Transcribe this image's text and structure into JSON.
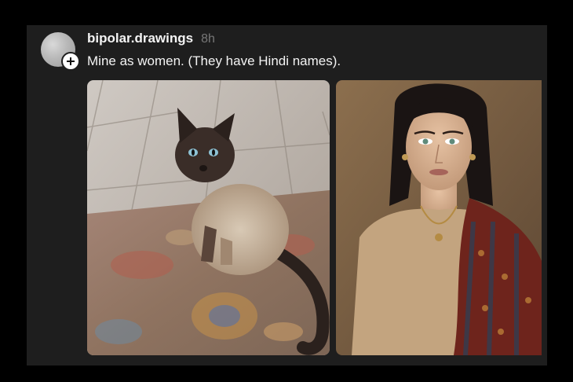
{
  "post": {
    "username": "bipolar.drawings",
    "timestamp": "8h",
    "caption": "Mine as women. (They have Hindi names).",
    "avatar_icon": "avatar-placeholder",
    "follow_badge_icon": "plus-icon"
  },
  "media": [
    {
      "icon": "photo-cat",
      "subject": "siamese cat on a rug"
    },
    {
      "icon": "photo-woman",
      "subject": "woman in shawl"
    }
  ],
  "colors": {
    "background": "#000000",
    "card": "#1e1e1e",
    "text_primary": "#f3f3f3",
    "text_secondary": "#777777"
  }
}
